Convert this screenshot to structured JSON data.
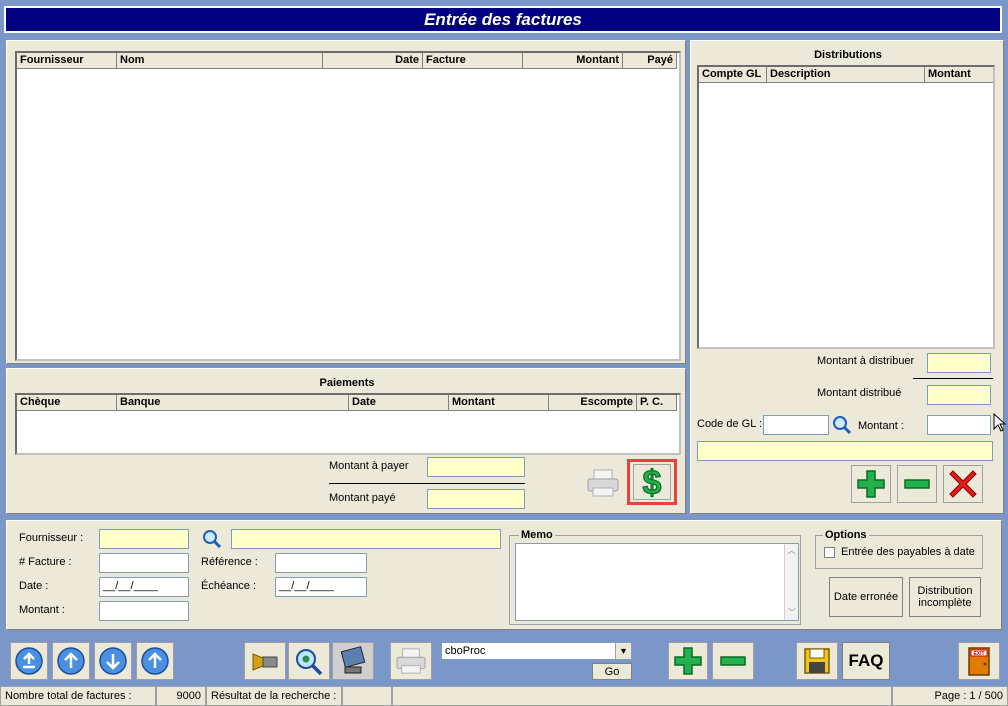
{
  "title": "Entrée des factures",
  "invoices": {
    "columns": [
      "Fournisseur",
      "Nom",
      "Date",
      "Facture",
      "Montant",
      "Payé"
    ]
  },
  "distributions": {
    "title": "Distributions",
    "columns": [
      "Compte GL",
      "Description",
      "Montant"
    ],
    "montant_a_distribuer": "Montant à distribuer",
    "montant_distribue": "Montant distribué",
    "code_gl": "Code de GL :",
    "montant": "Montant :"
  },
  "payments": {
    "title": "Paiements",
    "columns": [
      "Chèque",
      "Banque",
      "Date",
      "Montant",
      "Escompte",
      "P. C."
    ],
    "montant_a_payer": "Montant à payer",
    "montant_paye": "Montant payé"
  },
  "form": {
    "fournisseur": "Fournisseur :",
    "facture": "# Facture :",
    "date": "Date :",
    "date_value": "__/__/____",
    "montant": "Montant :",
    "reference": "Référence :",
    "echeance": "Échéance :",
    "echeance_value": "__/__/____",
    "memo": "Memo"
  },
  "options": {
    "title": "Options",
    "checkbox": "Entrée des payables à date",
    "date_erronee": "Date erronée",
    "distribution_incomplete": "Distribution incomplète"
  },
  "toolbar": {
    "combo_value": "cboProc",
    "go": "Go",
    "faq": "FAQ",
    "exit": "EXIT"
  },
  "status": {
    "total_label": "Nombre total de factures :",
    "total_value": "9000",
    "result_label": "Résultat de la recherche :",
    "page": "Page : 1 / 500"
  },
  "colors": {
    "title_bg": "#000080",
    "field_yellow": "#ffffc8",
    "toolbar_bg": "#7b96c9",
    "highlight": "#e8403c"
  }
}
